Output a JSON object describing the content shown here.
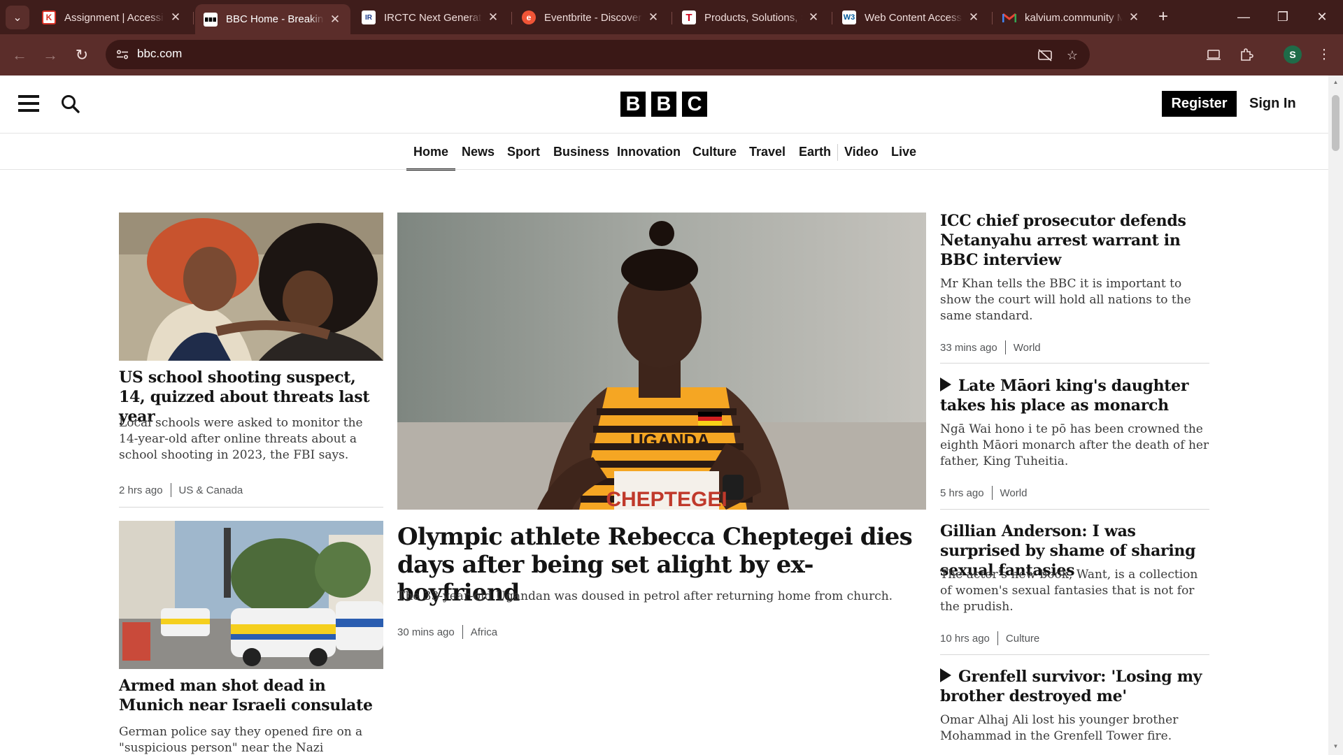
{
  "browser": {
    "tabs": [
      {
        "title": "Assignment | Accessibility",
        "favicon": "kalvium-icon",
        "color": "#d93025"
      },
      {
        "title": "BBC Home - Breaking News",
        "favicon": "bbc-icon",
        "color": "#ffffff"
      },
      {
        "title": "IRCTC Next Generation",
        "favicon": "irctc-icon",
        "color": "#ffffff"
      },
      {
        "title": "Eventbrite - Discover",
        "favicon": "eventbrite-icon",
        "color": "#f05537"
      },
      {
        "title": "Products, Solutions, S",
        "favicon": "t-icon",
        "color": "#ffffff"
      },
      {
        "title": "Web Content Accessib",
        "favicon": "w3c-icon",
        "color": "#ffffff"
      },
      {
        "title": "kalvium.community M",
        "favicon": "gmail-icon",
        "color": "#ffffff"
      }
    ],
    "url": "bbc.com",
    "profile_initial": "S"
  },
  "header": {
    "logo_letters": [
      "B",
      "B",
      "C"
    ],
    "register_label": "Register",
    "signin_label": "Sign In"
  },
  "nav": {
    "items": [
      "Home",
      "News",
      "Sport",
      "Business",
      "Innovation",
      "Culture",
      "Travel",
      "Earth",
      "Video",
      "Live"
    ],
    "active": "Home"
  },
  "left_column": [
    {
      "headline": "US school shooting suspect, 14, quizzed about threats last year",
      "summary": "Local schools were asked to monitor the 14-year-old after online threats about a school shooting in 2023, the FBI says.",
      "time": "2 hrs ago",
      "section": "US & Canada"
    },
    {
      "headline": "Armed man shot dead in Munich near Israeli consulate",
      "summary": "German police say they opened fire on a \"suspicious person\" near the Nazi"
    }
  ],
  "main_story": {
    "headline": "Olympic athlete Rebecca Cheptegei dies days after being set alight by ex-boyfriend",
    "summary": "The 33-year-old Ugandan was doused in petrol after returning home from church.",
    "time": "30 mins ago",
    "section": "Africa",
    "image_text": [
      "UGANDA",
      "CHEPTEGEI"
    ]
  },
  "right_column": [
    {
      "headline": "ICC chief prosecutor defends Netanyahu arrest warrant in BBC interview",
      "summary": "Mr Khan tells the BBC it is important to show the court will hold all nations to the same standard.",
      "time": "33 mins ago",
      "section": "World",
      "video": false
    },
    {
      "headline": "Late Māori king's daughter takes his place as monarch",
      "summary": "Ngā Wai hono i te pō has been crowned the eighth Māori monarch after the death of her father, King Tuheitia.",
      "time": "5 hrs ago",
      "section": "World",
      "video": true
    },
    {
      "headline": "Gillian Anderson: I was surprised by shame of sharing sexual fantasies",
      "summary": "The actor's new book, Want, is a collection of women's sexual fantasies that is not for the prudish.",
      "time": "10 hrs ago",
      "section": "Culture",
      "video": false
    },
    {
      "headline": "Grenfell survivor: 'Losing my brother destroyed me'",
      "summary": "Omar Alhaj Ali lost his younger brother Mohammad in the Grenfell Tower fire.",
      "video": true
    }
  ]
}
